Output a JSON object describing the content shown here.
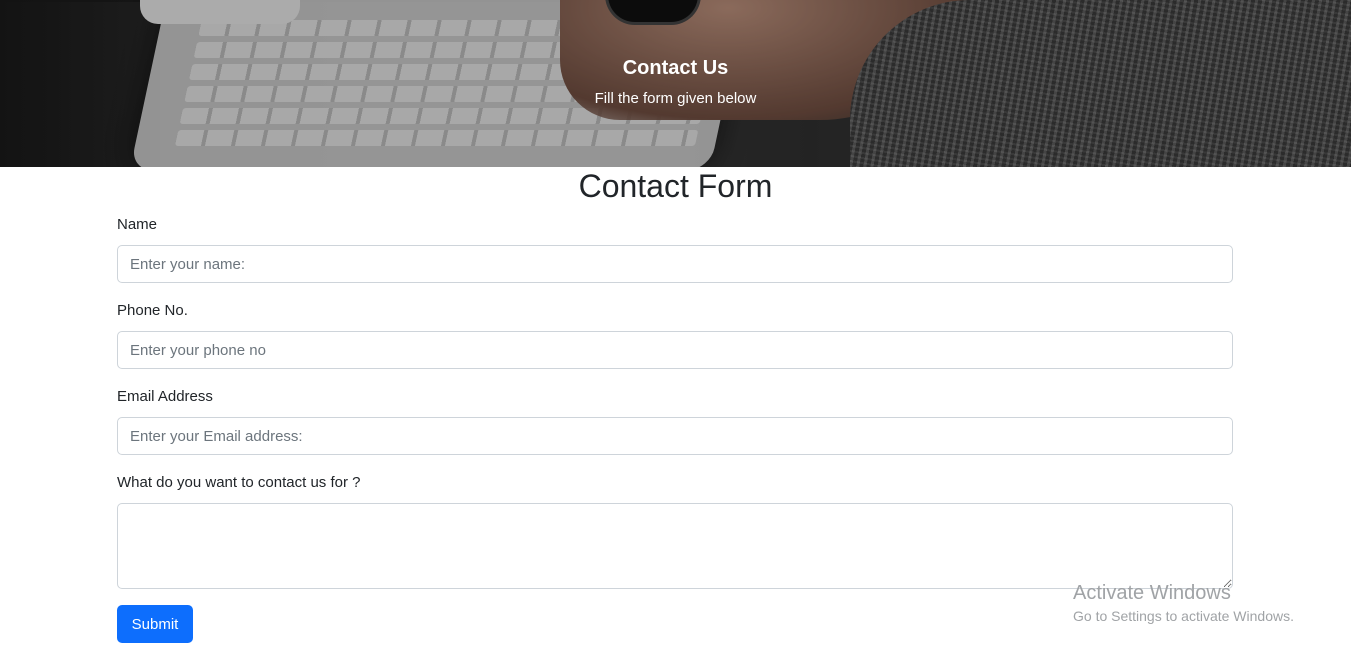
{
  "hero": {
    "title": "Contact Us",
    "subtitle": "Fill the form given below"
  },
  "form": {
    "title": "Contact Form",
    "fields": {
      "name": {
        "label": "Name",
        "placeholder": "Enter your name:",
        "value": ""
      },
      "phone": {
        "label": "Phone No.",
        "placeholder": "Enter your phone no",
        "value": ""
      },
      "email": {
        "label": "Email Address",
        "placeholder": "Enter your Email address:",
        "value": ""
      },
      "message": {
        "label": "What do you want to contact us for ?",
        "value": ""
      }
    },
    "submit_label": "Submit"
  },
  "watermark": {
    "title": "Activate Windows",
    "subtitle": "Go to Settings to activate Windows."
  },
  "colors": {
    "primary": "#0d6efd",
    "border": "#ced4da",
    "text": "#212529",
    "placeholder": "#6c757d"
  }
}
